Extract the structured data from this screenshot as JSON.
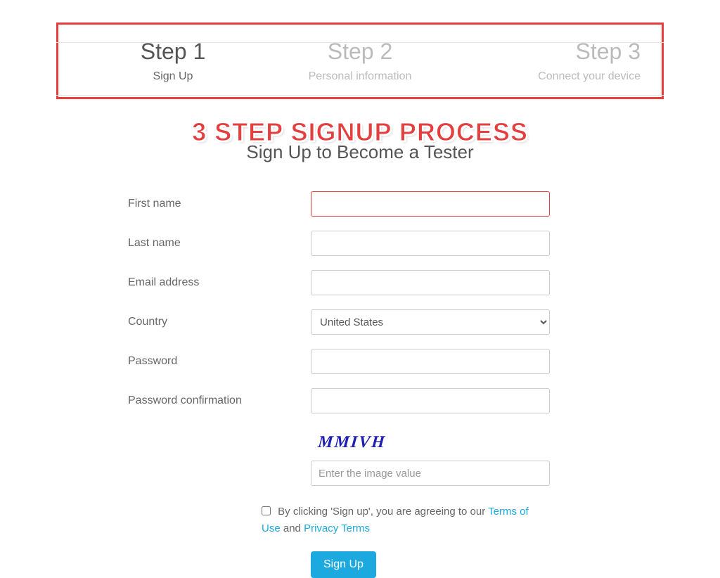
{
  "steps": [
    {
      "title": "Step 1",
      "subtitle": "Sign Up",
      "active": true
    },
    {
      "title": "Step 2",
      "subtitle": "Personal information",
      "active": false
    },
    {
      "title": "Step 3",
      "subtitle": "Connect your device",
      "active": false
    }
  ],
  "annotation": "3 STEP SIGNUP PROCESS",
  "form": {
    "heading": "Sign Up to Become a Tester",
    "fields": {
      "first_name": {
        "label": "First name",
        "value": ""
      },
      "last_name": {
        "label": "Last name",
        "value": ""
      },
      "email": {
        "label": "Email address",
        "value": ""
      },
      "country": {
        "label": "Country",
        "value": "United States"
      },
      "password": {
        "label": "Password",
        "value": ""
      },
      "password_confirm": {
        "label": "Password confirmation",
        "value": ""
      }
    },
    "captcha": {
      "text": "MMIVH",
      "placeholder": "Enter the image value"
    },
    "terms": {
      "prefix": "By clicking 'Sign up', you are agreeing to our ",
      "terms_of_use": "Terms of Use",
      "connector": " and ",
      "privacy_terms": "Privacy Terms"
    },
    "submit_label": "Sign Up"
  }
}
